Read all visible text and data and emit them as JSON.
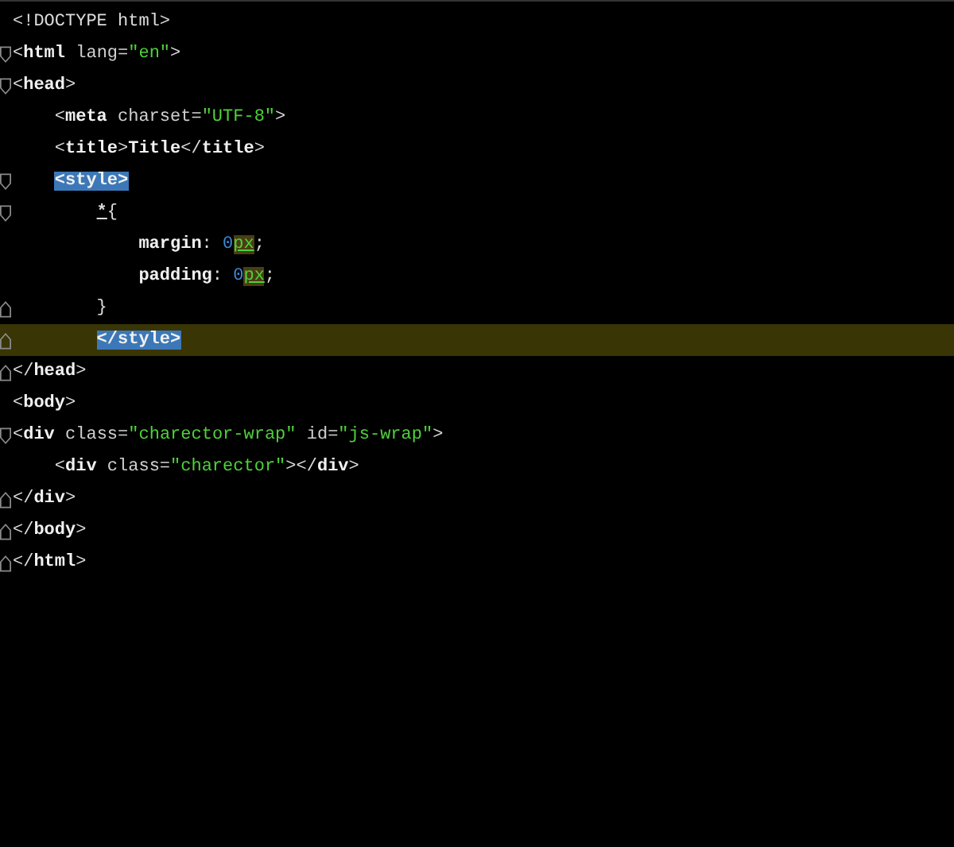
{
  "lines": [
    {
      "fold_start": false,
      "fold_end": false,
      "current": false,
      "tokens": [
        {
          "kind": "punct",
          "text": "<!DOCTYPE html>"
        }
      ]
    },
    {
      "fold_start": true,
      "fold_end": false,
      "current": false,
      "tokens": [
        {
          "kind": "punct",
          "text": "<"
        },
        {
          "kind": "tag",
          "text": "html"
        },
        {
          "kind": "attr",
          "text": " lang="
        },
        {
          "kind": "string",
          "text": "\"en\""
        },
        {
          "kind": "punct",
          "text": ">"
        }
      ]
    },
    {
      "fold_start": true,
      "fold_end": false,
      "current": false,
      "tokens": [
        {
          "kind": "punct",
          "text": "<"
        },
        {
          "kind": "tag",
          "text": "head"
        },
        {
          "kind": "punct",
          "text": ">"
        }
      ],
      "children": [
        {
          "fold_start": false,
          "fold_end": false,
          "current": false,
          "tokens": [
            {
              "kind": "punct",
              "text": "<"
            },
            {
              "kind": "tag",
              "text": "meta"
            },
            {
              "kind": "attr",
              "text": " charset="
            },
            {
              "kind": "string",
              "text": "\"UTF-8\""
            },
            {
              "kind": "punct",
              "text": ">"
            }
          ]
        },
        {
          "fold_start": false,
          "fold_end": false,
          "current": false,
          "tokens": [
            {
              "kind": "punct",
              "text": "<"
            },
            {
              "kind": "tag",
              "text": "title"
            },
            {
              "kind": "punct",
              "text": ">"
            },
            {
              "kind": "tag",
              "text": "Title"
            },
            {
              "kind": "punct",
              "text": "</"
            },
            {
              "kind": "tag",
              "text": "title"
            },
            {
              "kind": "punct",
              "text": ">"
            }
          ]
        },
        {
          "fold_start": true,
          "fold_end": false,
          "current": false,
          "tokens": [
            {
              "kind": "match",
              "text": "<style>"
            }
          ],
          "children": [
            {
              "fold_start": true,
              "fold_end": false,
              "current": false,
              "tokens": [
                {
                  "kind": "selector",
                  "text": "*"
                },
                {
                  "kind": "punct",
                  "text": "{"
                }
              ],
              "children": [
                {
                  "fold_start": false,
                  "fold_end": false,
                  "current": false,
                  "tokens": [
                    {
                      "kind": "tag",
                      "text": "margin"
                    },
                    {
                      "kind": "punct",
                      "text": ": "
                    },
                    {
                      "kind": "number",
                      "text": "0"
                    },
                    {
                      "kind": "unit",
                      "text": "px"
                    },
                    {
                      "kind": "punct",
                      "text": ";"
                    }
                  ]
                },
                {
                  "fold_start": false,
                  "fold_end": false,
                  "current": false,
                  "tokens": [
                    {
                      "kind": "tag",
                      "text": "padding"
                    },
                    {
                      "kind": "punct",
                      "text": ": "
                    },
                    {
                      "kind": "number",
                      "text": "0"
                    },
                    {
                      "kind": "unit",
                      "text": "px"
                    },
                    {
                      "kind": "punct",
                      "text": ";"
                    }
                  ]
                }
              ]
            },
            {
              "fold_start": false,
              "fold_end": true,
              "current": false,
              "tokens": [
                {
                  "kind": "punct",
                  "text": "}"
                }
              ]
            },
            {
              "fold_start": false,
              "fold_end": true,
              "current": true,
              "tokens": [
                {
                  "kind": "match",
                  "text": "</style>"
                }
              ]
            }
          ]
        }
      ]
    },
    {
      "fold_start": false,
      "fold_end": true,
      "current": false,
      "tokens": [
        {
          "kind": "punct",
          "text": "</"
        },
        {
          "kind": "tag",
          "text": "head"
        },
        {
          "kind": "punct",
          "text": ">"
        }
      ]
    },
    {
      "fold_start": false,
      "fold_end": false,
      "current": false,
      "tokens": [
        {
          "kind": "punct",
          "text": "<"
        },
        {
          "kind": "tag",
          "text": "body"
        },
        {
          "kind": "punct",
          "text": ">"
        }
      ]
    },
    {
      "fold_start": true,
      "fold_end": false,
      "current": false,
      "tokens": [
        {
          "kind": "punct",
          "text": "<"
        },
        {
          "kind": "tag",
          "text": "div"
        },
        {
          "kind": "attr",
          "text": " class="
        },
        {
          "kind": "string",
          "text": "\"charector-wrap\""
        },
        {
          "kind": "attr",
          "text": " id="
        },
        {
          "kind": "string",
          "text": "\"js-wrap\""
        },
        {
          "kind": "punct",
          "text": ">"
        }
      ],
      "children": [
        {
          "fold_start": false,
          "fold_end": false,
          "current": false,
          "tokens": [
            {
              "kind": "punct",
              "text": "<"
            },
            {
              "kind": "tag",
              "text": "div"
            },
            {
              "kind": "attr",
              "text": " class="
            },
            {
              "kind": "string",
              "text": "\"charector\""
            },
            {
              "kind": "punct",
              "text": "></"
            },
            {
              "kind": "tag",
              "text": "div"
            },
            {
              "kind": "punct",
              "text": ">"
            }
          ]
        }
      ]
    },
    {
      "fold_start": false,
      "fold_end": true,
      "current": false,
      "tokens": [
        {
          "kind": "punct",
          "text": "</"
        },
        {
          "kind": "tag",
          "text": "div"
        },
        {
          "kind": "punct",
          "text": ">"
        }
      ]
    },
    {
      "fold_start": false,
      "fold_end": true,
      "current": false,
      "tokens": [
        {
          "kind": "punct",
          "text": "</"
        },
        {
          "kind": "tag",
          "text": "body"
        },
        {
          "kind": "punct",
          "text": ">"
        }
      ]
    },
    {
      "fold_start": false,
      "fold_end": true,
      "current": false,
      "tokens": [
        {
          "kind": "punct",
          "text": "</"
        },
        {
          "kind": "tag",
          "text": "html"
        },
        {
          "kind": "punct",
          "text": ">"
        }
      ]
    }
  ]
}
